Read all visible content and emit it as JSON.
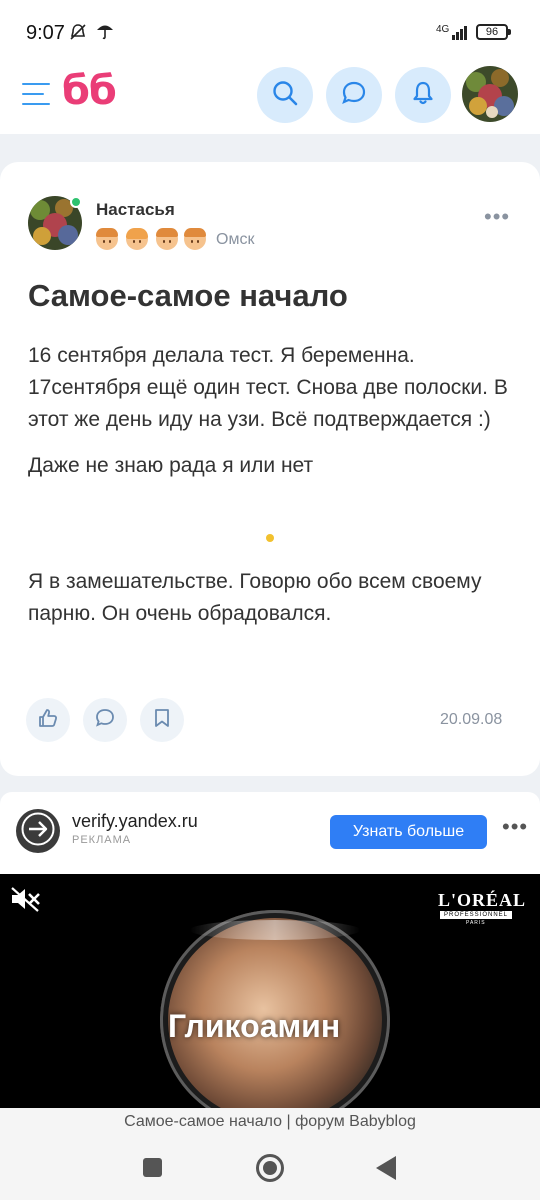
{
  "status_bar": {
    "time": "9:07",
    "network": "4G",
    "battery": "96",
    "icons": [
      "mute-icon",
      "umbrella-icon",
      "signal-icon",
      "battery-icon"
    ]
  },
  "app_bar": {
    "logo": "бб",
    "icons": [
      "menu-icon",
      "search-icon",
      "chat-icon",
      "bell-icon",
      "avatar"
    ],
    "accent_color": "#3a9bf0",
    "logo_color": "#ea3d77"
  },
  "post": {
    "author": "Настасья",
    "city": "Омск",
    "title": "Самое-самое начало",
    "paragraphs": [
      "16 сентября делала тест. Я беременна. 17сентября ещё один тест. Снова две полоски. В этот же день иду на узи. Всё подтверждается :)",
      "Даже не знаю рада я или нет"
    ],
    "paragraph_after_emoji": "Я в замешательстве. Говорю обо всем своему парню. Он очень обрадовался.",
    "date": "20.09.08",
    "actions": [
      "like-icon",
      "comment-icon",
      "bookmark-icon"
    ]
  },
  "ad": {
    "domain": "verify.yandex.ru",
    "label": "РЕКЛАМА",
    "button": "Узнать больше",
    "brand": "L'ORÉAL",
    "brand_sub": "PROFESSIONNEL",
    "brand_city": "PARIS",
    "product": "Гликоамин",
    "button_color": "#2f7ef5"
  },
  "browser": {
    "page_title": "Самое-самое начало | форум Babyblog"
  }
}
